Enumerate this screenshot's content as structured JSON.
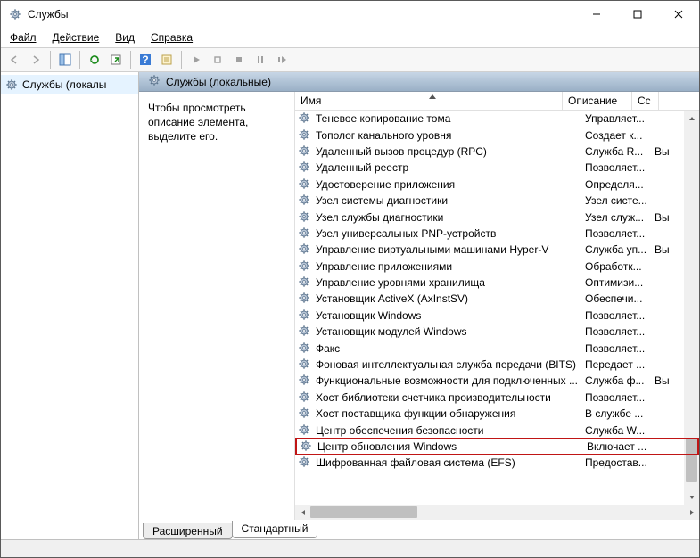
{
  "window": {
    "title": "Службы"
  },
  "menu": {
    "file": "Файл",
    "action": "Действие",
    "view": "Вид",
    "help": "Справка"
  },
  "tree": {
    "root": "Службы (локалы"
  },
  "panel": {
    "title": "Службы (локальные)"
  },
  "description": "Чтобы просмотреть описание элемента, выделите его.",
  "columns": {
    "name": "Имя",
    "desc": "Описание",
    "startup": "Сс"
  },
  "tabs": {
    "extended": "Расширенный",
    "standard": "Стандартный"
  },
  "services": [
    {
      "name": "Теневое копирование тома",
      "desc": "Управляет...",
      "startup": ""
    },
    {
      "name": "Тополог канального уровня",
      "desc": "Создает к...",
      "startup": ""
    },
    {
      "name": "Удаленный вызов процедур (RPC)",
      "desc": "Служба R...",
      "startup": "Вы"
    },
    {
      "name": "Удаленный реестр",
      "desc": "Позволяет...",
      "startup": ""
    },
    {
      "name": "Удостоверение приложения",
      "desc": "Определя...",
      "startup": ""
    },
    {
      "name": "Узел системы диагностики",
      "desc": "Узел систе...",
      "startup": ""
    },
    {
      "name": "Узел службы диагностики",
      "desc": "Узел служ...",
      "startup": "Вы"
    },
    {
      "name": "Узел универсальных PNP-устройств",
      "desc": "Позволяет...",
      "startup": ""
    },
    {
      "name": "Управление виртуальными машинами Hyper-V",
      "desc": "Служба уп...",
      "startup": "Вы"
    },
    {
      "name": "Управление приложениями",
      "desc": "Обработк...",
      "startup": ""
    },
    {
      "name": "Управление уровнями хранилища",
      "desc": "Оптимизи...",
      "startup": ""
    },
    {
      "name": "Установщик ActiveX (AxInstSV)",
      "desc": "Обеспечи...",
      "startup": ""
    },
    {
      "name": "Установщик Windows",
      "desc": "Позволяет...",
      "startup": ""
    },
    {
      "name": "Установщик модулей Windows",
      "desc": "Позволяет...",
      "startup": ""
    },
    {
      "name": "Факс",
      "desc": "Позволяет...",
      "startup": ""
    },
    {
      "name": "Фоновая интеллектуальная служба передачи (BITS)",
      "desc": "Передает ...",
      "startup": ""
    },
    {
      "name": "Функциональные возможности для подключенных ...",
      "desc": "Служба ф...",
      "startup": "Вы"
    },
    {
      "name": "Хост библиотеки счетчика производительности",
      "desc": "Позволяет...",
      "startup": ""
    },
    {
      "name": "Хост поставщика функции обнаружения",
      "desc": "В службе ...",
      "startup": ""
    },
    {
      "name": "Центр обеспечения безопасности",
      "desc": "Служба W...",
      "startup": ""
    },
    {
      "name": "Центр обновления Windows",
      "desc": "Включает ...",
      "startup": "",
      "highlight": true
    },
    {
      "name": "Шифрованная файловая система (EFS)",
      "desc": "Предостав...",
      "startup": ""
    }
  ]
}
